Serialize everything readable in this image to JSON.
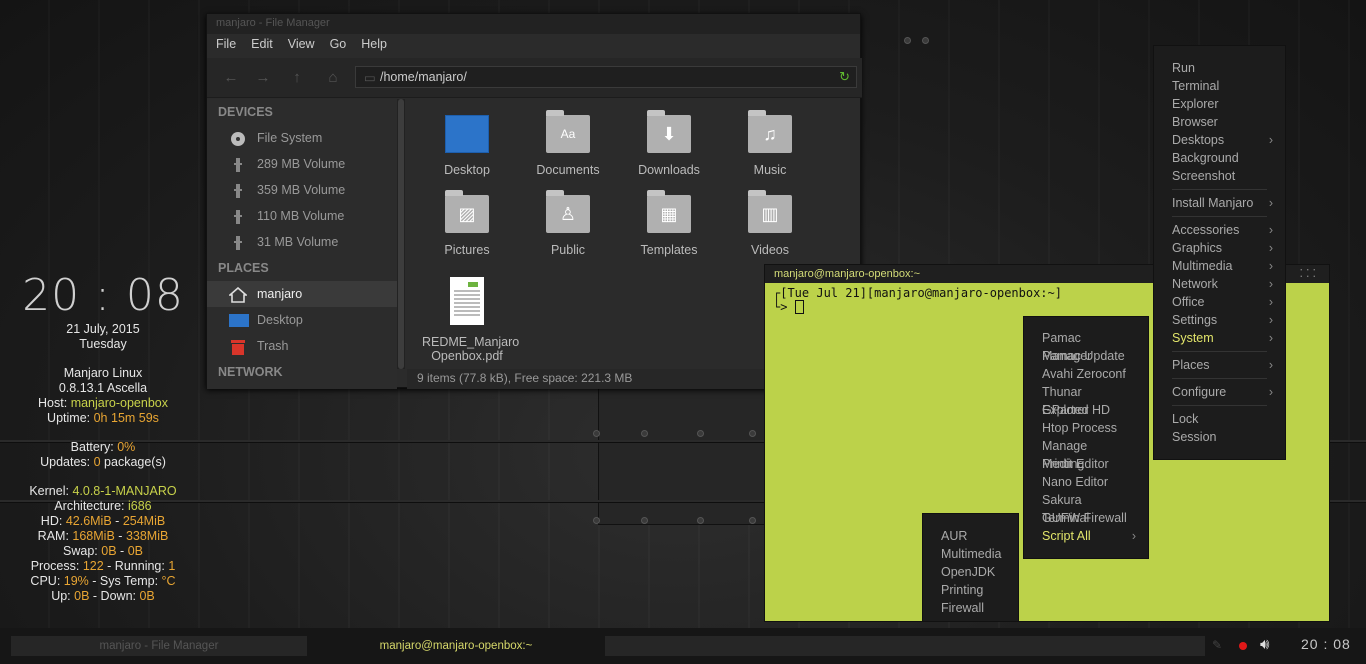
{
  "conky": {
    "time": "20 : 08",
    "date": "21 July, 2015",
    "day": "Tuesday",
    "os": "Manjaro Linux",
    "version": "0.8.13.1 Ascella",
    "host_label": "Host:",
    "host": "manjaro-openbox",
    "uptime_label": "Uptime:",
    "uptime": "0h 15m 59s",
    "battery_label": "Battery:",
    "battery": "0%",
    "updates_label": "Updates:",
    "updates": "0",
    "updates_suffix": "package(s)",
    "kernel_label": "Kernel:",
    "kernel": "4.0.8-1-MANJARO",
    "arch_label": "Architecture:",
    "arch": "i686",
    "hd_label": "HD:",
    "hd_used": "42.6MiB",
    "hd_sep": "-",
    "hd_total": "254MiB",
    "ram_label": "RAM:",
    "ram_used": "168MiB",
    "ram_sep": "-",
    "ram_total": "338MiB",
    "swap_label": "Swap:",
    "swap_used": "0B",
    "swap_sep": "-",
    "swap_total": "0B",
    "process_label": "Process:",
    "process": "122",
    "running_label": "- Running:",
    "running": "1",
    "cpu_label": "CPU:",
    "cpu": "19%",
    "systemp_label": "- Sys Temp:",
    "systemp": "°C",
    "up_label": "Up:",
    "up": "0B",
    "down_label": "- Down:",
    "down": "0B"
  },
  "file_manager": {
    "title": "manjaro - File Manager",
    "menu": [
      "File",
      "Edit",
      "View",
      "Go",
      "Help"
    ],
    "path": "/home/manjaro/",
    "devices_header": "DEVICES",
    "devices": [
      "File System",
      "289 MB Volume",
      "359 MB Volume",
      "110 MB Volume",
      "31 MB Volume"
    ],
    "places_header": "PLACES",
    "places": [
      "manjaro",
      "Desktop",
      "Trash"
    ],
    "network_header": "NETWORK",
    "files": [
      {
        "name": "Desktop",
        "icon": "desktop-thumb"
      },
      {
        "name": "Documents",
        "icon": "documents-folder-icon",
        "glyph": "Aa"
      },
      {
        "name": "Downloads",
        "icon": "downloads-folder-icon",
        "glyph": "⬇"
      },
      {
        "name": "Music",
        "icon": "music-folder-icon",
        "glyph": "♫"
      },
      {
        "name": "Pictures",
        "icon": "pictures-folder-icon",
        "glyph": "▨"
      },
      {
        "name": "Public",
        "icon": "public-folder-icon",
        "glyph": "♙"
      },
      {
        "name": "Templates",
        "icon": "templates-folder-icon",
        "glyph": "▦"
      },
      {
        "name": "Videos",
        "icon": "videos-folder-icon",
        "glyph": "▥"
      },
      {
        "name_line1": "REDME_Manjaro",
        "name_line2": "Openbox.pdf",
        "icon": "pdf-file-icon"
      }
    ],
    "status": "9 items (77.8 kB), Free space: 221.3 MB"
  },
  "terminal": {
    "title": "manjaro@manjaro-openbox:~",
    "line1": "┌[Tue Jul 21][manjaro@manjaro-openbox:~]",
    "line2": "└> "
  },
  "root_menu": {
    "group1": [
      "Run",
      "Terminal",
      "Explorer",
      "Browser",
      "Desktops",
      "Background",
      "Screenshot"
    ],
    "group2": [
      "Install Manjaro"
    ],
    "group3": [
      "Accessories",
      "Graphics",
      "Multimedia",
      "Network",
      "Office",
      "Settings",
      "System"
    ],
    "group4": [
      "Places"
    ],
    "group5": [
      "Configure"
    ],
    "group6": [
      "Lock",
      "Session"
    ],
    "arrow": "›"
  },
  "system_menu": {
    "items": [
      "Pamac Manager",
      "Pamac Update",
      "Avahi Zeroconf",
      "Thunar Explorer",
      "GParted HD",
      "Htop Process",
      "Manage Printing",
      "Medit Editor",
      "Nano Editor",
      "Sakura Terminal",
      "GUFW Firewall",
      "Script All"
    ]
  },
  "script_menu": {
    "items": [
      "AUR",
      "Multimedia",
      "OpenJDK",
      "Printing",
      "Firewall"
    ]
  },
  "taskbar": {
    "task1": "manjaro - File Manager",
    "task2": "manjaro@manjaro-openbox:~",
    "clock": "20 : 08",
    "record_color": "#e01818"
  },
  "colors": {
    "accent": "#e1e46a",
    "conky_value": "#e8a533",
    "terminal_bg": "#bcd24a"
  }
}
